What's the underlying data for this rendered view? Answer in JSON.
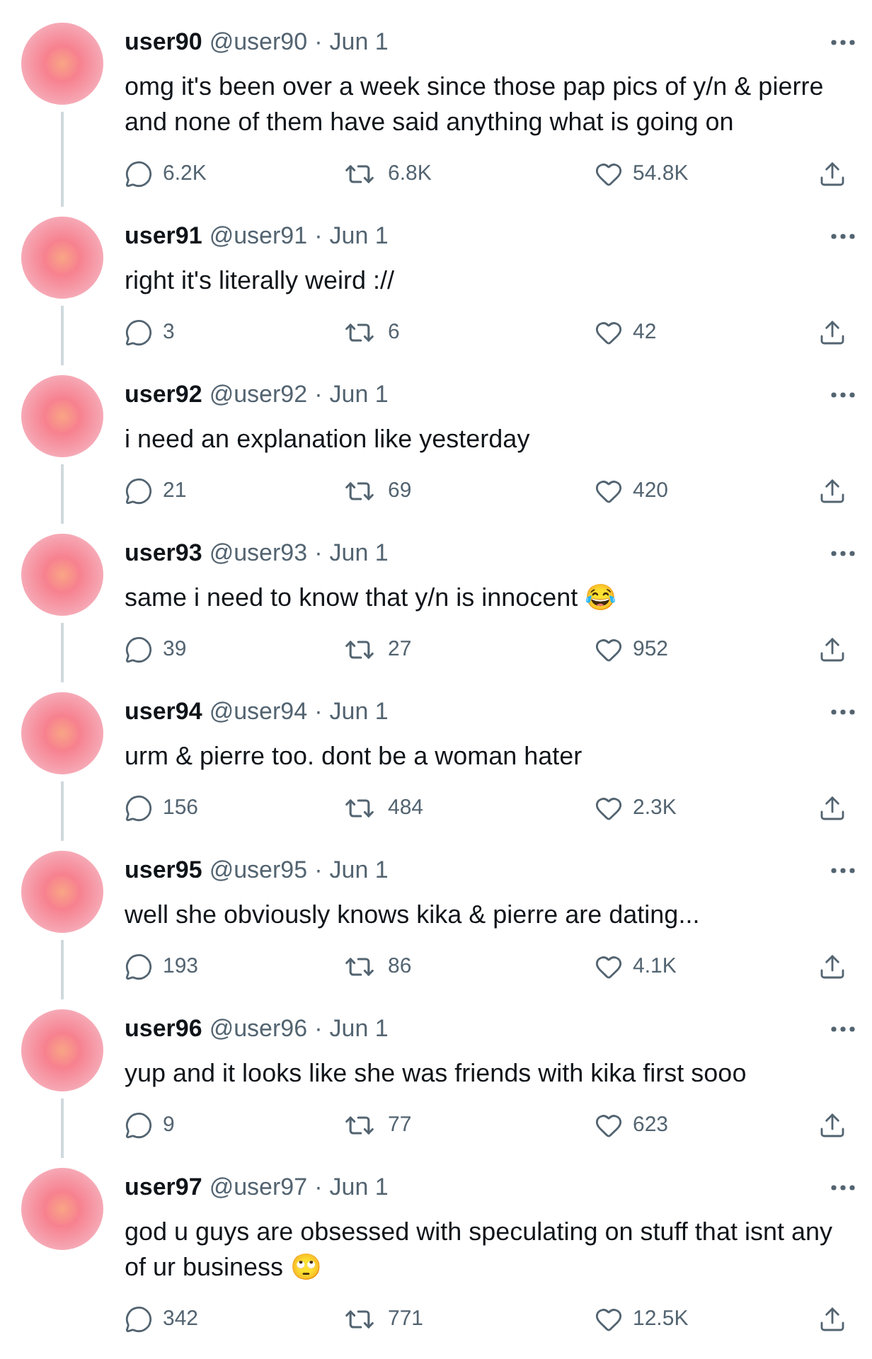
{
  "tweets": [
    {
      "display_name": "user90",
      "handle": "@user90",
      "separator": "·",
      "date": "Jun 1",
      "text": "omg it's been over a week since those pap pics of y/n & pierre and none of them have said anything what is going on",
      "replies": "6.2K",
      "retweets": "6.8K",
      "likes": "54.8K"
    },
    {
      "display_name": "user91",
      "handle": "@user91",
      "separator": "·",
      "date": "Jun 1",
      "text": "right it's literally weird ://",
      "replies": "3",
      "retweets": "6",
      "likes": "42"
    },
    {
      "display_name": "user92",
      "handle": "@user92",
      "separator": "·",
      "date": "Jun 1",
      "text": "i need an explanation like yesterday",
      "replies": "21",
      "retweets": "69",
      "likes": "420"
    },
    {
      "display_name": "user93",
      "handle": "@user93",
      "separator": "·",
      "date": "Jun 1",
      "text": "same i need to know that y/n is innocent 😂",
      "replies": "39",
      "retweets": "27",
      "likes": "952"
    },
    {
      "display_name": "user94",
      "handle": "@user94",
      "separator": "·",
      "date": "Jun 1",
      "text": "urm & pierre too. dont be a woman hater",
      "replies": "156",
      "retweets": "484",
      "likes": "2.3K"
    },
    {
      "display_name": "user95",
      "handle": "@user95",
      "separator": "·",
      "date": "Jun 1",
      "text": "well she obviously knows kika & pierre are dating...",
      "replies": "193",
      "retweets": "86",
      "likes": "4.1K"
    },
    {
      "display_name": "user96",
      "handle": "@user96",
      "separator": "·",
      "date": "Jun 1",
      "text": "yup and it looks like she was friends with kika first sooo",
      "replies": "9",
      "retweets": "77",
      "likes": "623"
    },
    {
      "display_name": "user97",
      "handle": "@user97",
      "separator": "·",
      "date": "Jun 1",
      "text": "god u guys are obsessed with speculating on stuff that isnt any of ur business 🙄",
      "replies": "342",
      "retweets": "771",
      "likes": "12.5K"
    }
  ]
}
